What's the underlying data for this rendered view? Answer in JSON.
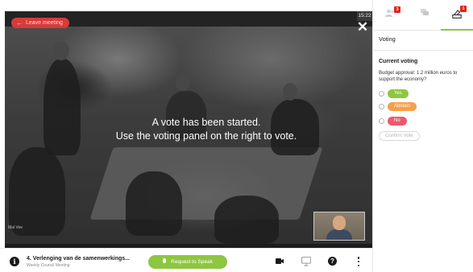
{
  "video": {
    "leave_label": "Leave meeting",
    "clock": "15:22",
    "message_line1": "A vote has been started.",
    "message_line2": "Use the voting panel on the right to vote.",
    "watermark": "Mal Vee"
  },
  "bottom_bar": {
    "agenda_title": "4. Verlenging van de samenwerkings...",
    "agenda_subtitle": "Weekly Council Meeting",
    "speak_label": "Request to Speak"
  },
  "panel": {
    "tabs": [
      {
        "name": "participants",
        "badge": "3"
      },
      {
        "name": "chat",
        "badge": ""
      },
      {
        "name": "voting",
        "badge": "1",
        "active": true
      }
    ],
    "title": "Voting",
    "current_label": "Current voting",
    "question": "Budget approval: 1.2 million euros to support the economy?",
    "options": [
      {
        "label": "Yes",
        "color": "#8dc63f"
      },
      {
        "label": "Abstain",
        "color": "#f6a04d"
      },
      {
        "label": "No",
        "color": "#ec5a6a"
      }
    ],
    "confirm_label": "Confirm Vote"
  },
  "colors": {
    "accent_green": "#8dc63f",
    "leave_red": "#d93a3a",
    "badge_red": "#e2231a"
  }
}
